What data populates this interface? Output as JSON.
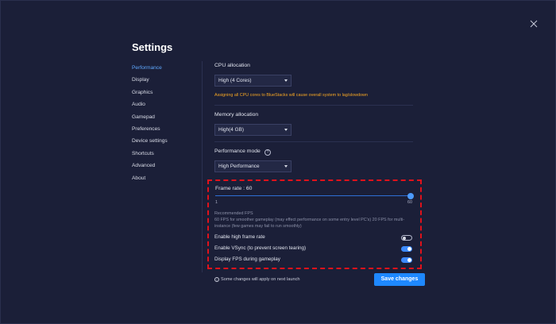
{
  "title": "Settings",
  "sidebar": {
    "items": [
      {
        "label": "Performance",
        "active": true
      },
      {
        "label": "Display"
      },
      {
        "label": "Graphics"
      },
      {
        "label": "Audio"
      },
      {
        "label": "Gamepad"
      },
      {
        "label": "Preferences"
      },
      {
        "label": "Device settings"
      },
      {
        "label": "Shortcuts"
      },
      {
        "label": "Advanced"
      },
      {
        "label": "About"
      }
    ]
  },
  "cpu": {
    "label": "CPU allocation",
    "value": "High (4 Cores)",
    "warning": "Assigning all CPU cores to BlueStacks will cause overall system to lag/slowdown"
  },
  "memory": {
    "label": "Memory allocation",
    "value": "High(4 GB)"
  },
  "performance_mode": {
    "label": "Performance mode",
    "help_icon": "?",
    "value": "High Performance"
  },
  "frame_rate": {
    "label": "Frame rate : 60",
    "min": "1",
    "max": "60",
    "value": 60,
    "recommended_title": "Recommended FPS",
    "recommended_text": "60 FPS for smoother gameplay (may effect performance on some entry level PC's) 20 FPS for multi-instance (few games may fail to run smoothly)"
  },
  "toggles": [
    {
      "label": "Enable high frame rate",
      "state": "off"
    },
    {
      "label": "Enable VSync (to prevent screen tearing)",
      "state": "on"
    },
    {
      "label": "Display FPS during gameplay",
      "state": "on"
    }
  ],
  "footer": {
    "info_icon": "i",
    "note": "Some changes will apply on next launch",
    "save_label": "Save changes"
  },
  "colors": {
    "accent": "#1e88ff",
    "warning": "#f5a623",
    "highlight": "#e0121b",
    "background": "#1b1f38"
  }
}
